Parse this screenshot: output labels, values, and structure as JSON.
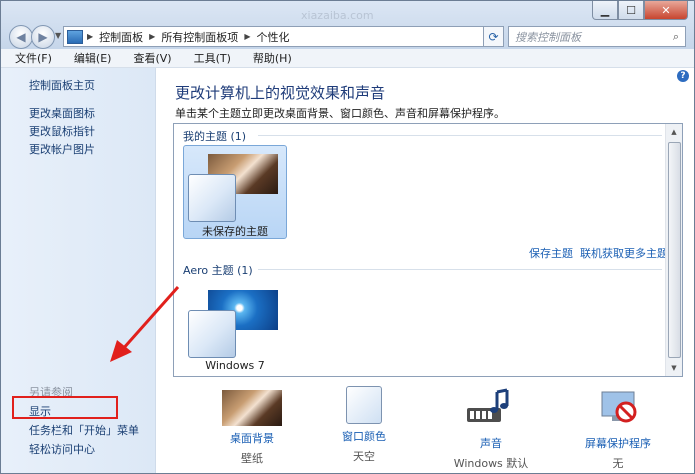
{
  "watermark": "xiazaiba.com",
  "address_bar": {
    "crumbs": [
      "控制面板",
      "所有控制面板项",
      "个性化"
    ]
  },
  "search": {
    "placeholder": "搜索控制面板"
  },
  "menu": [
    "文件(F)",
    "编辑(E)",
    "查看(V)",
    "工具(T)",
    "帮助(H)"
  ],
  "sidebar": {
    "links": [
      "控制面板主页",
      "更改桌面图标",
      "更改鼠标指针",
      "更改帐户图片"
    ],
    "see_also_heading": "另请参阅",
    "see_also_links": [
      "显示",
      "任务栏和「开始」菜单",
      "轻松访问中心"
    ]
  },
  "main": {
    "title": "更改计算机上的视觉效果和声音",
    "description": "单击某个主题立即更改桌面背景、窗口颜色、声音和屏幕保护程序。",
    "my_themes": {
      "label": "我的主题 (1)",
      "tile_label": "未保存的主题",
      "save_link": "保存主题",
      "online_link": "联机获取更多主题"
    },
    "aero_themes": {
      "label": "Aero 主题 (1)",
      "tile_label": "Windows 7"
    },
    "quick_settings": [
      {
        "label": "桌面背景",
        "sub": "壁纸",
        "icon": "wallpaper-thumbnail-icon"
      },
      {
        "label": "窗口颜色",
        "sub": "天空",
        "icon": "window-color-icon"
      },
      {
        "label": "声音",
        "sub": "Windows 默认",
        "icon": "sound-notes-icon"
      },
      {
        "label": "屏幕保护程序",
        "sub": "无",
        "icon": "screensaver-icon"
      }
    ]
  },
  "colors": {
    "annotation_red": "#e1201c",
    "link_blue": "#1a5fb4",
    "title_blue": "#1f3c7a"
  }
}
